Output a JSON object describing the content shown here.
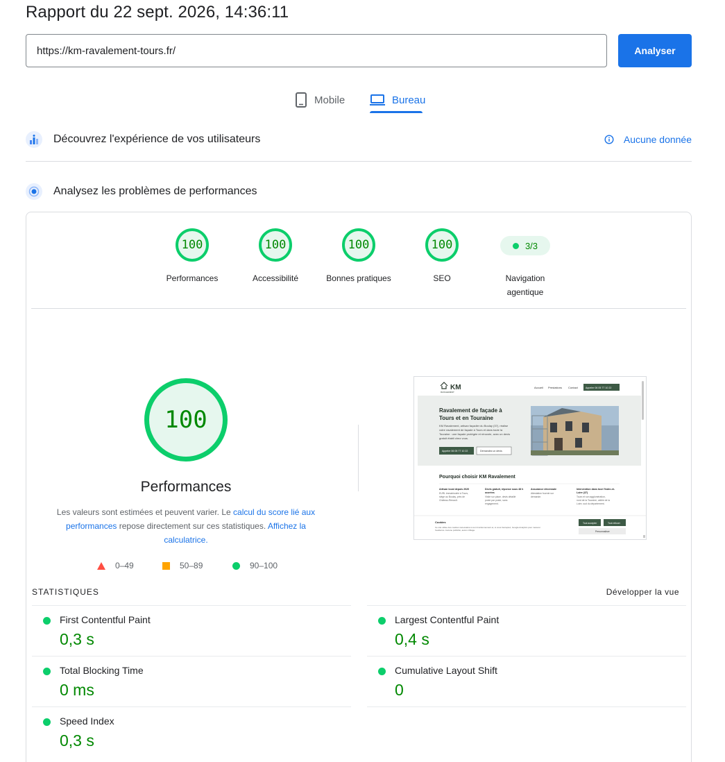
{
  "header": {
    "title": "Rapport du 22 sept. 2026, 14:36:11"
  },
  "search": {
    "url_value": "https://km-ravalement-tours.fr/",
    "analyze_label": "Analyser"
  },
  "tabs": [
    {
      "label": "Mobile",
      "icon": "smartphone-icon",
      "active": false
    },
    {
      "label": "Bureau",
      "icon": "laptop-icon",
      "active": true
    }
  ],
  "field_section": {
    "title": "Découvrez l'expérience de vos utilisateurs",
    "status_label": "Aucune donnée",
    "status_icon": "info-icon"
  },
  "lab_section": {
    "title": "Analysez les problèmes de performances"
  },
  "categories": [
    {
      "label": "Performances",
      "score": "100"
    },
    {
      "label": "Accessibilité",
      "score": "100"
    },
    {
      "label": "Bonnes pratiques",
      "score": "100"
    },
    {
      "label": "SEO",
      "score": "100"
    },
    {
      "label": "Navigation agentique",
      "score": "3/3"
    }
  ],
  "performance": {
    "score": "100",
    "label": "Performances",
    "explain_prefix": "Les valeurs sont estimées et peuvent varier. Le ",
    "explain_link1": "calcul du score lié aux performances",
    "explain_middle": " repose directement sur ces statistiques. ",
    "explain_link2": "Affichez la calculatrice."
  },
  "legend": {
    "fail": "0–49",
    "average": "50–89",
    "pass": "90–100"
  },
  "colors": {
    "pass": "#0cce6b",
    "average": "#ffa400",
    "fail": "#ff4e42",
    "accent": "#1a73e8",
    "pass_text": "#008800"
  },
  "screenshot": {
    "logo": "KM",
    "logo_sub": "RAVALEMENT",
    "nav": [
      "Accueil",
      "Prestations",
      "Contact"
    ],
    "nav_cta": "Appeler 06 05 77 10 22",
    "hero_title": "Ravalement de façade à Tours et en Touraine",
    "hero_text": "KM Ravalement, artisan façadier du Boulay (37), réalise votre ravalement de façade à Tours et dans toute la Touraine : une façade protégée et rénovée, avec un devis gratuit établi chez vous.",
    "hero_btn1": "Appeler 06 05 77 10 22",
    "hero_btn2": "Demandez un devis",
    "section_title": "Pourquoi choisir KM Ravalement",
    "cols": [
      {
        "title": "Artisan local depuis 2020",
        "text": "EURL immatriculée à Tours, siège au Boulay, près de Château-Renault."
      },
      {
        "title": "Devis gratuit, réponse sous 48 h ouvrées",
        "text": "Visite sur place, devis détaillé poste par poste, sans engagement."
      },
      {
        "title": "Assurance décennale",
        "text": "Attestation fournie sur demande."
      },
      {
        "title": "Intervention dans tout l'Indre-et-Loire (37)",
        "text": "Tours et son agglomération, nord de la Touraine, vallée de la Loire, sud du département."
      }
    ],
    "cookie_title": "Cookies",
    "cookie_text": "Ce site utilise des cookies nécessaires à son fonctionnement et, si vous l'acceptez, Google Analytics pour mesurer l'audience. Aucune publicité, aucun ciblage.",
    "cookie_accept": "Tout accepter",
    "cookie_refuse": "Tout refuser",
    "cookie_custom": "Personnaliser"
  },
  "stats": {
    "heading": "STATISTIQUES",
    "expand_label": "Développer la vue",
    "metrics": [
      {
        "name": "First Contentful Paint",
        "value": "0,3 s"
      },
      {
        "name": "Largest Contentful Paint",
        "value": "0,4 s"
      },
      {
        "name": "Total Blocking Time",
        "value": "0 ms"
      },
      {
        "name": "Cumulative Layout Shift",
        "value": "0"
      },
      {
        "name": "Speed Index",
        "value": "0,3 s"
      }
    ]
  }
}
